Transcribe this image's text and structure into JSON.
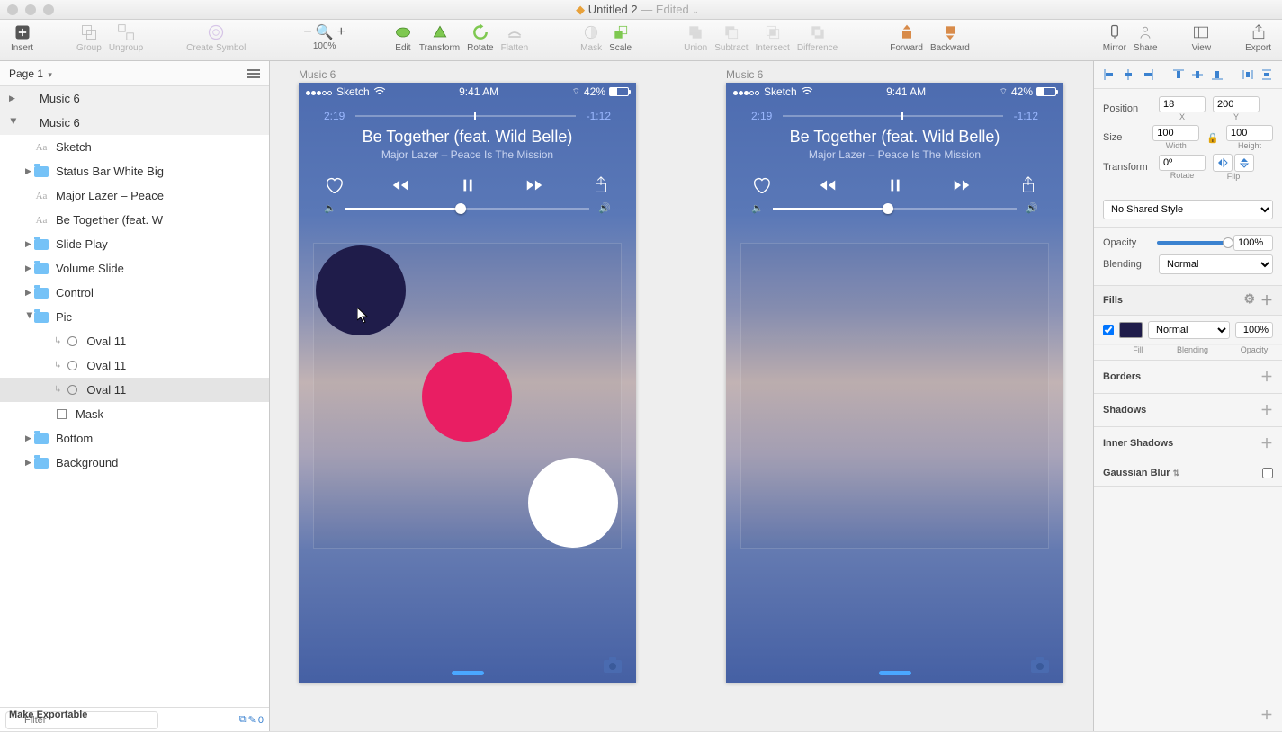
{
  "window": {
    "title": "Untitled 2",
    "status": "Edited"
  },
  "toolbar": {
    "insert": "Insert",
    "group": "Group",
    "ungroup": "Ungroup",
    "create_symbol": "Create Symbol",
    "zoom_pct": "100%",
    "edit": "Edit",
    "transform": "Transform",
    "rotate": "Rotate",
    "flatten": "Flatten",
    "mask": "Mask",
    "scale": "Scale",
    "union": "Union",
    "subtract": "Subtract",
    "intersect": "Intersect",
    "difference": "Difference",
    "forward": "Forward",
    "backward": "Backward",
    "mirror": "Mirror",
    "share": "Share",
    "view": "View",
    "export": "Export"
  },
  "page": {
    "label": "Page 1"
  },
  "layers": [
    {
      "name": "Music 6",
      "type": "artboard",
      "indent": 0,
      "disclose": "closed"
    },
    {
      "name": "Music 6",
      "type": "artboard",
      "indent": 0,
      "disclose": "open"
    },
    {
      "name": "Sketch",
      "type": "text",
      "indent": 1
    },
    {
      "name": "Status Bar White Big",
      "type": "folder",
      "indent": 1,
      "disclose": "closed"
    },
    {
      "name": "Major Lazer – Peace",
      "type": "text",
      "indent": 1
    },
    {
      "name": "Be Together (feat. W",
      "type": "text",
      "indent": 1
    },
    {
      "name": "Slide Play",
      "type": "folder",
      "indent": 1,
      "disclose": "closed"
    },
    {
      "name": "Volume Slide",
      "type": "folder",
      "indent": 1,
      "disclose": "closed"
    },
    {
      "name": "Control",
      "type": "folder",
      "indent": 1,
      "disclose": "closed"
    },
    {
      "name": "Pic",
      "type": "folder",
      "indent": 1,
      "disclose": "open"
    },
    {
      "name": "Oval 11",
      "type": "oval",
      "indent": 2,
      "masked": true
    },
    {
      "name": "Oval 11",
      "type": "oval",
      "indent": 2,
      "masked": true
    },
    {
      "name": "Oval 11",
      "type": "oval",
      "indent": 2,
      "masked": true,
      "selected": true
    },
    {
      "name": "Mask",
      "type": "rect",
      "indent": 2
    },
    {
      "name": "Bottom",
      "type": "folder",
      "indent": 1,
      "disclose": "closed"
    },
    {
      "name": "Background",
      "type": "folder",
      "indent": 1,
      "disclose": "closed"
    }
  ],
  "filter": {
    "placeholder": "Filter",
    "count": "0"
  },
  "artboards": {
    "label": "Music 6"
  },
  "phone": {
    "carrier": "Sketch",
    "time": "9:41 AM",
    "battery": "42%",
    "elapsed": "2:19",
    "remaining": "-1:12",
    "title": "Be Together (feat. Wild Belle)",
    "subtitle": "Major Lazer – Peace Is The Mission"
  },
  "inspector": {
    "position_label": "Position",
    "pos_x": "18",
    "pos_y": "200",
    "x_label": "X",
    "y_label": "Y",
    "size_label": "Size",
    "w": "100",
    "h": "100",
    "w_label": "Width",
    "h_label": "Height",
    "transform_label": "Transform",
    "rotate": "0º",
    "rotate_label": "Rotate",
    "flip_label": "Flip",
    "shared_style": "No Shared Style",
    "opacity_label": "Opacity",
    "opacity_value": "100%",
    "blending_label": "Blending",
    "blending_value": "Normal",
    "fills_label": "Fills",
    "fill_color": "#1f1c4a",
    "fill_blending": "Normal",
    "fill_opacity": "100%",
    "fill_sub": "Fill",
    "blend_sub": "Blending",
    "op_sub": "Opacity",
    "borders_label": "Borders",
    "shadows_label": "Shadows",
    "inner_shadows_label": "Inner Shadows",
    "blur_label": "Gaussian Blur",
    "exportable_label": "Make Exportable"
  }
}
